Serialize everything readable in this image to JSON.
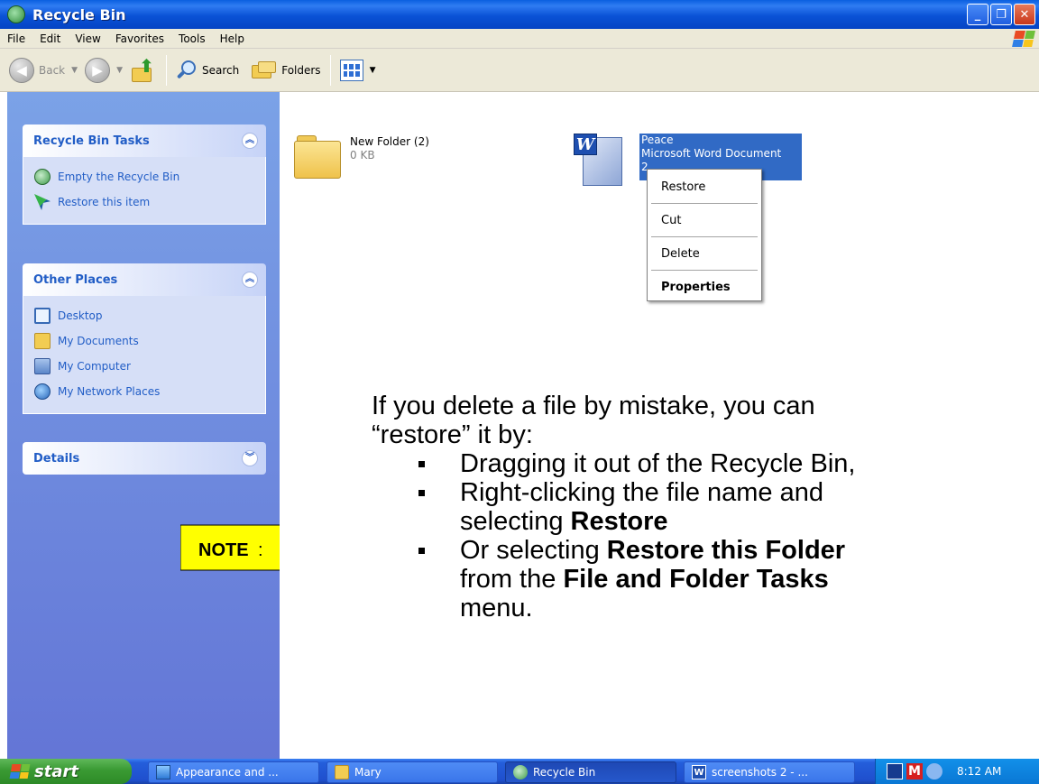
{
  "window": {
    "title": "Recycle Bin",
    "buttons": {
      "minimize": "_",
      "maximize": "❐",
      "close": "✕"
    }
  },
  "menubar": [
    "File",
    "Edit",
    "View",
    "Favorites",
    "Tools",
    "Help"
  ],
  "toolbar": {
    "back": "Back",
    "search": "Search",
    "folders": "Folders"
  },
  "sidebar": {
    "recycle_tasks": {
      "title": "Recycle Bin Tasks",
      "items": [
        {
          "label": "Empty the Recycle Bin",
          "icon": "recycle-icon"
        },
        {
          "label": "Restore this item",
          "icon": "restore-icon"
        }
      ]
    },
    "other_places": {
      "title": "Other Places",
      "items": [
        {
          "label": "Desktop",
          "icon": "desktop-icon"
        },
        {
          "label": "My Documents",
          "icon": "my-documents-icon"
        },
        {
          "label": "My Computer",
          "icon": "my-computer-icon"
        },
        {
          "label": "My Network Places",
          "icon": "network-places-icon"
        }
      ]
    },
    "details": {
      "title": "Details"
    }
  },
  "note": {
    "label": "NOTE",
    "suffix": ":"
  },
  "files": [
    {
      "name": "New Folder (2)",
      "meta": "0 KB",
      "icon": "folder-icon"
    },
    {
      "name": "Peace",
      "meta": "Microsoft Word Document",
      "extra": "2",
      "icon": "word-document-icon",
      "selected": true
    }
  ],
  "context_menu": [
    "Restore",
    "Cut",
    "Delete",
    "Properties"
  ],
  "annotation": {
    "intro_line1": "If you delete a file by mistake, you can",
    "intro_line2": "“restore” it by:",
    "bullet1": "Dragging it out of the Recycle Bin,",
    "bullet2_a": "Right-clicking the file name and",
    "bullet2_b": "selecting ",
    "bullet2_bold": "Restore",
    "bullet3_a": "Or selecting ",
    "bullet3_bold1": "Restore this Folder",
    "bullet3_b": "from the ",
    "bullet3_bold2": "File and Folder Tasks",
    "bullet3_c": "menu."
  },
  "taskbar": {
    "start": "start",
    "tasks": [
      {
        "label": "Appearance and ...",
        "icon": "control-panel-icon"
      },
      {
        "label": "Mary",
        "icon": "folder-icon"
      },
      {
        "label": "Recycle Bin",
        "icon": "recycle-bin-icon",
        "active": true
      },
      {
        "label": "screenshots 2 - ...",
        "icon": "word-icon"
      }
    ],
    "clock": "8:12 AM"
  }
}
